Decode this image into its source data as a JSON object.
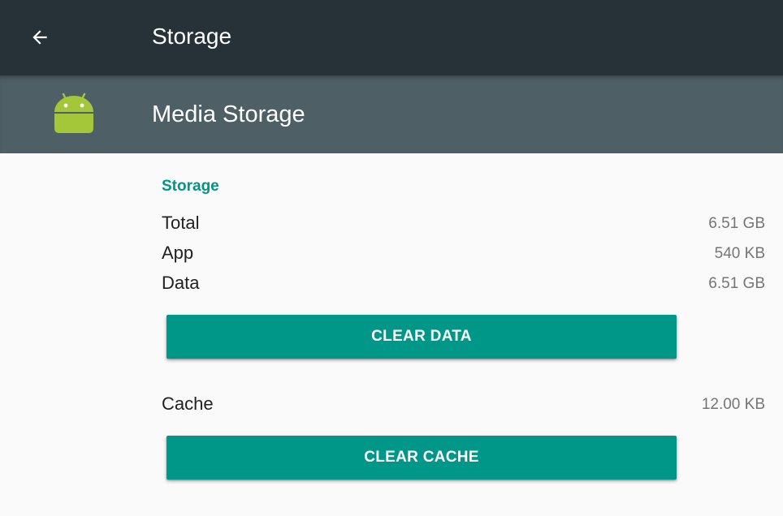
{
  "toolbar": {
    "title": "Storage",
    "back_icon": "arrow-back-icon"
  },
  "app_header": {
    "icon": "android-icon",
    "icon_color": "#a4c639",
    "name": "Media Storage"
  },
  "storage": {
    "section_title": "Storage",
    "rows": [
      {
        "label": "Total",
        "value": "6.51 GB"
      },
      {
        "label": "App",
        "value": "540 KB"
      },
      {
        "label": "Data",
        "value": "6.51 GB"
      }
    ],
    "clear_data_label": "CLEAR DATA",
    "cache": {
      "label": "Cache",
      "value": "12.00 KB"
    },
    "clear_cache_label": "CLEAR CACHE"
  },
  "colors": {
    "toolbar": "#263238",
    "header": "#4f5f66",
    "accent": "#009688",
    "background": "#fafafa"
  }
}
